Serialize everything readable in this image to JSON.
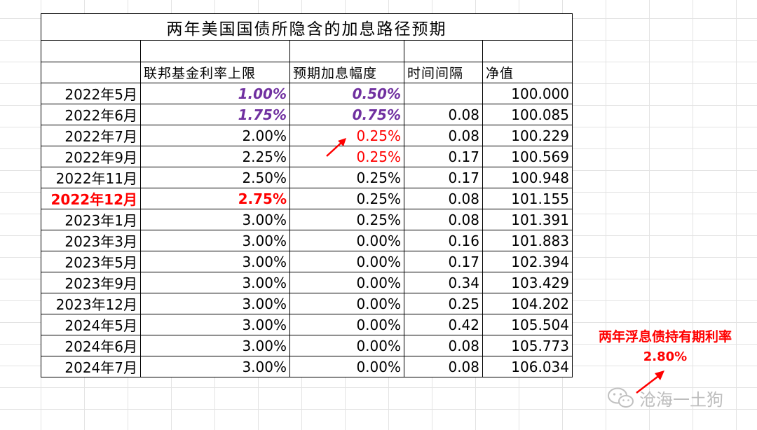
{
  "sheet": {
    "title": "两年美国国债所隐含的加息路径预期",
    "headers": [
      "",
      "联邦基金利率上限",
      "预期加息幅度",
      "时间间隔",
      "净值"
    ],
    "rows": [
      {
        "date": "2022年5月",
        "rate": "1.00%",
        "hike": "0.50%",
        "interval": "",
        "nav": "100.000"
      },
      {
        "date": "2022年6月",
        "rate": "1.75%",
        "hike": "0.75%",
        "interval": "0.08",
        "nav": "100.085"
      },
      {
        "date": "2022年7月",
        "rate": "2.00%",
        "hike": "0.25%",
        "interval": "0.08",
        "nav": "100.229"
      },
      {
        "date": "2022年9月",
        "rate": "2.25%",
        "hike": "0.25%",
        "interval": "0.17",
        "nav": "100.569"
      },
      {
        "date": "2022年11月",
        "rate": "2.50%",
        "hike": "0.25%",
        "interval": "0.17",
        "nav": "100.948"
      },
      {
        "date": "2022年12月",
        "rate": "2.75%",
        "hike": "0.25%",
        "interval": "0.08",
        "nav": "101.155"
      },
      {
        "date": "2023年1月",
        "rate": "3.00%",
        "hike": "0.25%",
        "interval": "0.08",
        "nav": "101.391"
      },
      {
        "date": "2023年3月",
        "rate": "3.00%",
        "hike": "0.00%",
        "interval": "0.16",
        "nav": "101.883"
      },
      {
        "date": "2023年5月",
        "rate": "3.00%",
        "hike": "0.00%",
        "interval": "0.17",
        "nav": "102.394"
      },
      {
        "date": "2023年9月",
        "rate": "3.00%",
        "hike": "0.00%",
        "interval": "0.34",
        "nav": "103.429"
      },
      {
        "date": "2023年12月",
        "rate": "3.00%",
        "hike": "0.00%",
        "interval": "0.25",
        "nav": "104.202"
      },
      {
        "date": "2024年5月",
        "rate": "3.00%",
        "hike": "0.00%",
        "interval": "0.42",
        "nav": "105.504"
      },
      {
        "date": "2024年6月",
        "rate": "3.00%",
        "hike": "0.00%",
        "interval": "0.08",
        "nav": "105.773"
      },
      {
        "date": "2024年7月",
        "rate": "3.00%",
        "hike": "0.00%",
        "interval": "0.08",
        "nav": "106.034"
      }
    ]
  },
  "annotation": {
    "label": "两年浮息债持有期利率",
    "value": "2.80%"
  },
  "watermark": {
    "text": "沧海一土狗",
    "icon": "wechat-icon"
  },
  "colors": {
    "purple": "#7030a0",
    "red": "#ff0000",
    "watermark": "#bdbdbd"
  }
}
